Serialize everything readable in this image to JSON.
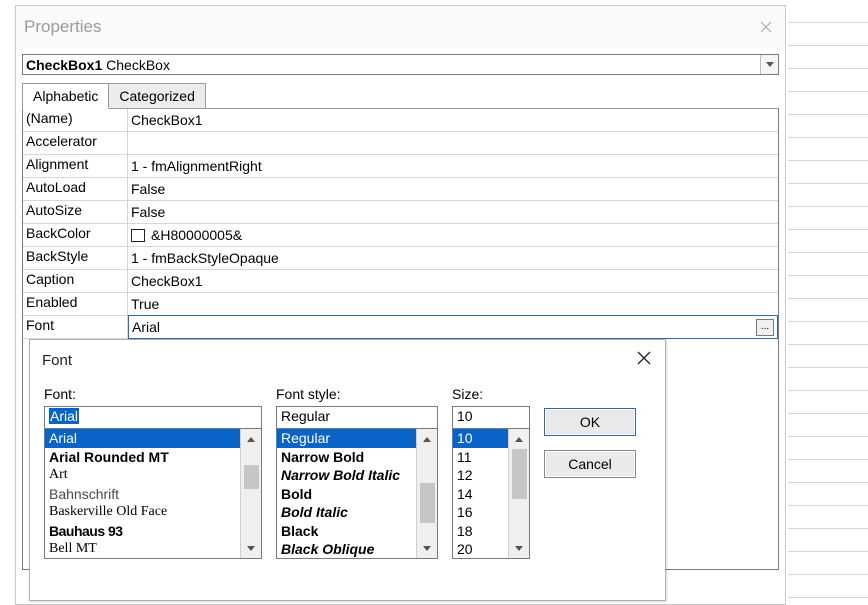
{
  "properties_window": {
    "title": "Properties",
    "object_selector": {
      "name": "CheckBox1",
      "type": "CheckBox"
    },
    "tabs": {
      "alphabetic": "Alphabetic",
      "categorized": "Categorized",
      "active": "alphabetic"
    },
    "rows": [
      {
        "label": "(Name)",
        "value": "CheckBox1"
      },
      {
        "label": "Accelerator",
        "value": ""
      },
      {
        "label": "Alignment",
        "value": "1 - fmAlignmentRight"
      },
      {
        "label": "AutoLoad",
        "value": "False"
      },
      {
        "label": "AutoSize",
        "value": "False"
      },
      {
        "label": "BackColor",
        "value": "&H80000005&",
        "is_color": true
      },
      {
        "label": "BackStyle",
        "value": "1 - fmBackStyleOpaque"
      },
      {
        "label": "Caption",
        "value": "CheckBox1"
      },
      {
        "label": "Enabled",
        "value": "True"
      },
      {
        "label": "Font",
        "value": "Arial",
        "has_ellipsis": true,
        "selected": true
      }
    ]
  },
  "font_dialog": {
    "title": "Font",
    "labels": {
      "font": "Font:",
      "style": "Font style:",
      "size": "Size:"
    },
    "font_input": "Arial",
    "style_input": "Regular",
    "size_input": "10",
    "font_list": [
      {
        "text": "Arial",
        "css": "",
        "selected": true
      },
      {
        "text": "Arial Rounded MT",
        "css": "font-arial-rounded"
      },
      {
        "text": "Art",
        "css": "font-art"
      },
      {
        "text": "Bahnschrift",
        "css": "font-bahnschrift"
      },
      {
        "text": "Baskerville Old Face",
        "css": "font-baskerville"
      },
      {
        "text": "Bauhaus 93",
        "css": "font-bauhaus"
      },
      {
        "text": "Bell MT",
        "css": "font-bellmt"
      }
    ],
    "style_list": [
      {
        "text": "Regular",
        "css": "",
        "selected": true
      },
      {
        "text": "Narrow Bold",
        "css": "fs-narrowbold"
      },
      {
        "text": "Narrow Bold Italic",
        "css": "fs-narrowbolditalic"
      },
      {
        "text": "Bold",
        "css": "fs-bold"
      },
      {
        "text": "Bold Italic",
        "css": "fs-bolditalic"
      },
      {
        "text": "Black",
        "css": "fs-bold"
      },
      {
        "text": "Black Oblique",
        "css": "fs-blackoblique"
      }
    ],
    "size_list": [
      {
        "text": "10",
        "selected": true
      },
      {
        "text": "11"
      },
      {
        "text": "12"
      },
      {
        "text": "14"
      },
      {
        "text": "16"
      },
      {
        "text": "18"
      },
      {
        "text": "20"
      }
    ],
    "buttons": {
      "ok": "OK",
      "cancel": "Cancel"
    }
  }
}
